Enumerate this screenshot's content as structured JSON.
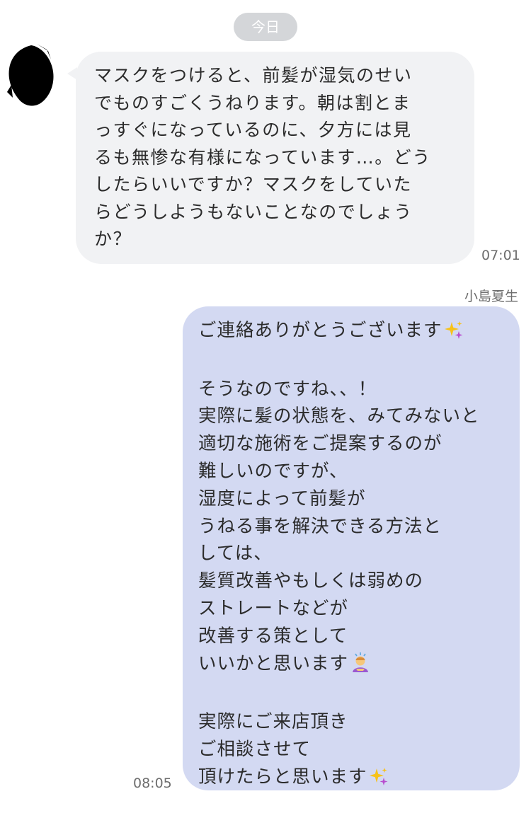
{
  "date_divider": "今日",
  "incoming": {
    "text": "マスクをつけると、前髪が湿気のせい\nでものすごくうねります。朝は割とま\nっすぐになっているのに、夕方には見\nるも無惨な有様になっています…。どう\nしたらいいですか？マスクをしていた\nらどうしようもないことなのでしょう\nか？",
    "time": "07:01"
  },
  "outgoing": {
    "sender": "小島夏生",
    "part1": "ご連絡ありがとうございます",
    "part2": "\n\nそうなのですね、、！\n実際に髪の状態を、みてみないと\n適切な施術をご提案するのが\n難しいのですが、\n湿度によって前髪が\nうねる事を解決できる方法と\nしては、\n髪質改善やもしくは弱めの\nストレートなどが\n改善する策として\nいいかと思います",
    "part3": "\n\n実際にご来店頂き\nご相談させて\n頂けたらと思います",
    "time": "08:05"
  },
  "emojis": [
    "sparkles-icon",
    "person-bowing-icon",
    "sparkles-icon"
  ],
  "colors": {
    "incoming_bubble": "#f1f2f4",
    "outgoing_bubble": "#d3d9f2",
    "date_pill": "#d4d6d9"
  }
}
